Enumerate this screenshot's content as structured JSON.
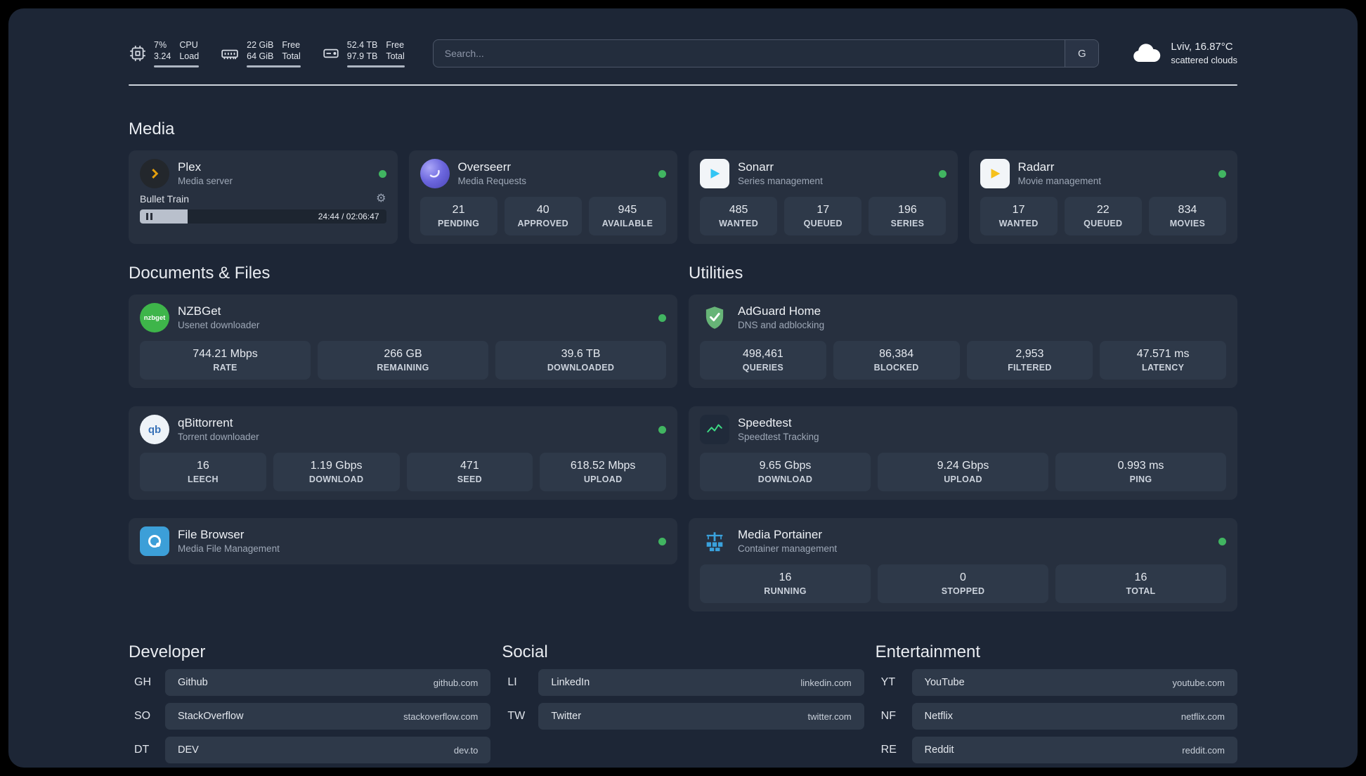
{
  "colors": {
    "status_online": "#41b561",
    "accent_plex": "#e5a00d",
    "accent_sonarr": "#33c5f4",
    "accent_radarr": "#f6c11c",
    "accent_nzbget": "#3eb54a",
    "accent_qbittorrent": "#3872b8",
    "accent_filebrowser": "#3c9fd8",
    "accent_adguard": "#67b477",
    "accent_speedtest": "#3ddc84",
    "accent_portainer": "#3aa2dd"
  },
  "topbar": {
    "cpu": {
      "value_top": "7%",
      "value_bottom": "3.24",
      "label_top": "CPU",
      "label_bottom": "Load"
    },
    "ram": {
      "value_top": "22 GiB",
      "value_bottom": "64 GiB",
      "label_top": "Free",
      "label_bottom": "Total"
    },
    "disk": {
      "value_top": "52.4 TB",
      "value_bottom": "97.9 TB",
      "label_top": "Free",
      "label_bottom": "Total"
    },
    "search": {
      "placeholder": "Search...",
      "engine_label": "G"
    },
    "weather": {
      "location": "Lviv, 16.87°C",
      "condition": "scattered clouds"
    }
  },
  "media": {
    "title": "Media",
    "plex": {
      "name": "Plex",
      "subtitle": "Media server",
      "now_playing": "Bullet Train",
      "time": "24:44 / 02:06:47",
      "progress_percent": 19.5
    },
    "apps": [
      {
        "name": "Overseerr",
        "subtitle": "Media Requests",
        "stats": [
          {
            "value": "21",
            "label": "PENDING"
          },
          {
            "value": "40",
            "label": "APPROVED"
          },
          {
            "value": "945",
            "label": "AVAILABLE"
          }
        ]
      },
      {
        "name": "Sonarr",
        "subtitle": "Series management",
        "stats": [
          {
            "value": "485",
            "label": "WANTED"
          },
          {
            "value": "17",
            "label": "QUEUED"
          },
          {
            "value": "196",
            "label": "SERIES"
          }
        ]
      },
      {
        "name": "Radarr",
        "subtitle": "Movie management",
        "stats": [
          {
            "value": "17",
            "label": "WANTED"
          },
          {
            "value": "22",
            "label": "QUEUED"
          },
          {
            "value": "834",
            "label": "MOVIES"
          }
        ]
      }
    ]
  },
  "documents": {
    "title": "Documents & Files",
    "apps": [
      {
        "name": "NZBGet",
        "subtitle": "Usenet downloader",
        "stats": [
          {
            "value": "744.21 Mbps",
            "label": "RATE"
          },
          {
            "value": "266 GB",
            "label": "REMAINING"
          },
          {
            "value": "39.6 TB",
            "label": "DOWNLOADED"
          }
        ]
      },
      {
        "name": "qBittorrent",
        "subtitle": "Torrent downloader",
        "stats": [
          {
            "value": "16",
            "label": "LEECH"
          },
          {
            "value": "1.19 Gbps",
            "label": "DOWNLOAD"
          },
          {
            "value": "471",
            "label": "SEED"
          },
          {
            "value": "618.52 Mbps",
            "label": "UPLOAD"
          }
        ]
      },
      {
        "name": "File Browser",
        "subtitle": "Media File Management",
        "stats": []
      }
    ]
  },
  "utilities": {
    "title": "Utilities",
    "apps": [
      {
        "name": "AdGuard Home",
        "subtitle": "DNS and adblocking",
        "stats": [
          {
            "value": "498,461",
            "label": "QUERIES"
          },
          {
            "value": "86,384",
            "label": "BLOCKED"
          },
          {
            "value": "2,953",
            "label": "FILTERED"
          },
          {
            "value": "47.571 ms",
            "label": "LATENCY"
          }
        ]
      },
      {
        "name": "Speedtest",
        "subtitle": "Speedtest Tracking",
        "stats": [
          {
            "value": "9.65 Gbps",
            "label": "DOWNLOAD"
          },
          {
            "value": "9.24 Gbps",
            "label": "UPLOAD"
          },
          {
            "value": "0.993 ms",
            "label": "PING"
          }
        ]
      },
      {
        "name": "Media Portainer",
        "subtitle": "Container management",
        "stats": [
          {
            "value": "16",
            "label": "RUNNING"
          },
          {
            "value": "0",
            "label": "STOPPED"
          },
          {
            "value": "16",
            "label": "TOTAL"
          }
        ]
      }
    ]
  },
  "bookmarks": {
    "developer": {
      "title": "Developer",
      "items": [
        {
          "abbr": "GH",
          "name": "Github",
          "url": "github.com"
        },
        {
          "abbr": "SO",
          "name": "StackOverflow",
          "url": "stackoverflow.com"
        },
        {
          "abbr": "DT",
          "name": "DEV",
          "url": "dev.to"
        }
      ]
    },
    "social": {
      "title": "Social",
      "items": [
        {
          "abbr": "LI",
          "name": "LinkedIn",
          "url": "linkedin.com"
        },
        {
          "abbr": "TW",
          "name": "Twitter",
          "url": "twitter.com"
        }
      ]
    },
    "entertainment": {
      "title": "Entertainment",
      "items": [
        {
          "abbr": "YT",
          "name": "YouTube",
          "url": "youtube.com"
        },
        {
          "abbr": "NF",
          "name": "Netflix",
          "url": "netflix.com"
        },
        {
          "abbr": "RE",
          "name": "Reddit",
          "url": "reddit.com"
        }
      ]
    }
  },
  "icons": {
    "gear": "⚙",
    "nzbget_text": "nzbget",
    "qb_text": "qb"
  }
}
